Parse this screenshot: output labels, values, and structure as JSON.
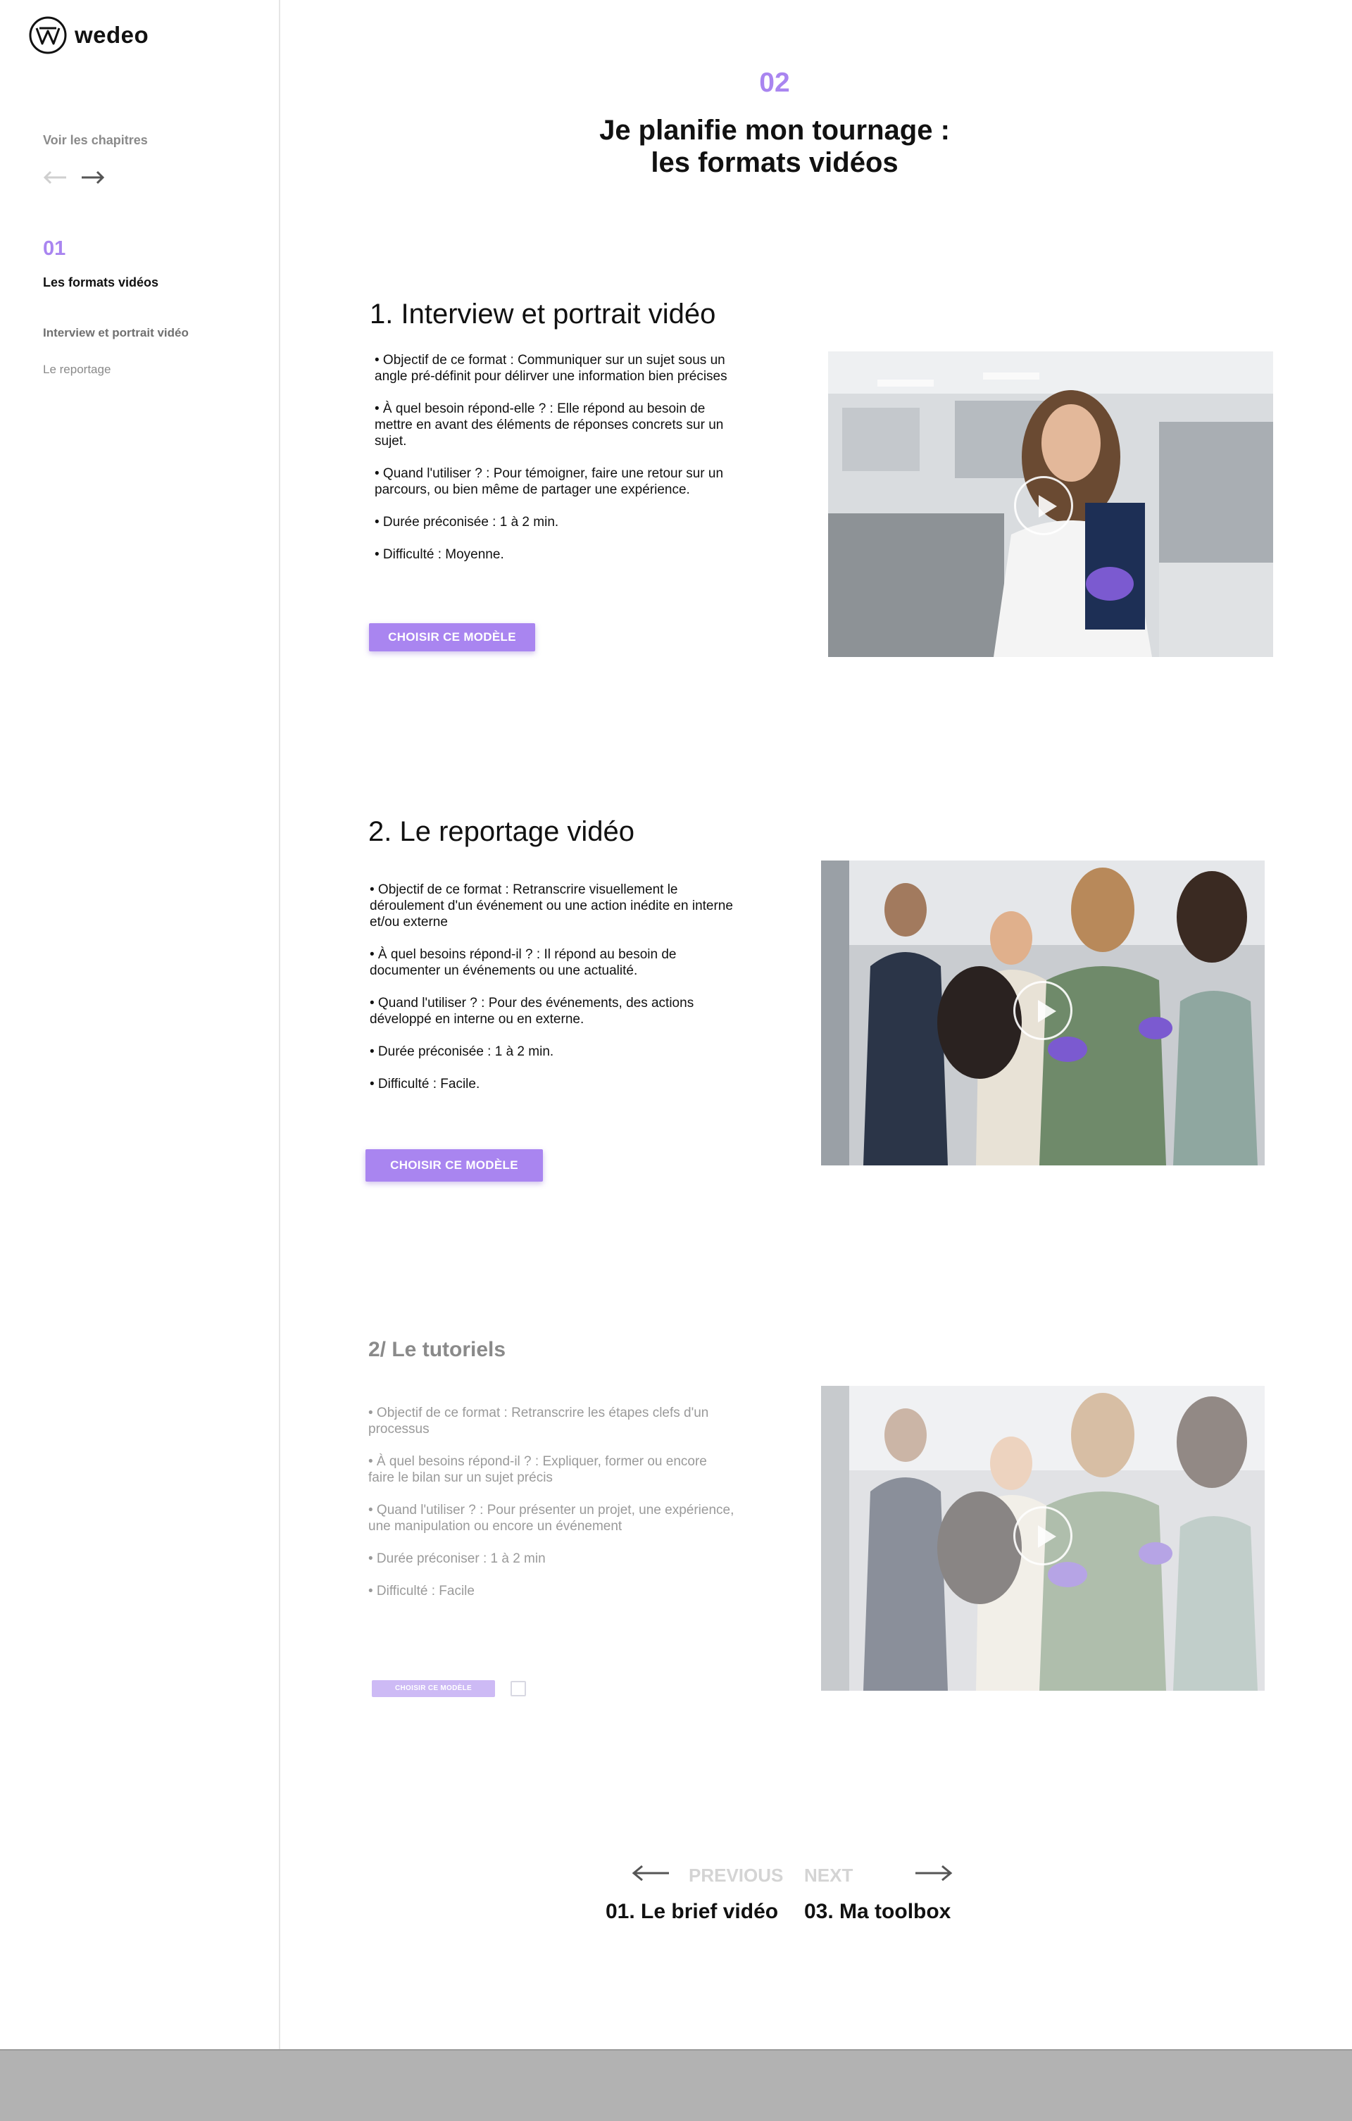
{
  "brand": {
    "name": "wedeo"
  },
  "sidebar": {
    "chapters_label": "Voir les chapitres",
    "current_number": "01",
    "current_title": "Les formats vidéos",
    "items": [
      {
        "label": "Interview et portrait vidéo"
      },
      {
        "label": "Le reportage"
      }
    ]
  },
  "header": {
    "chapter_number": "02",
    "title_line1": "Je planifie mon tournage :",
    "title_line2": "les formats vidéos"
  },
  "sections": [
    {
      "title": "1. Interview et portrait vidéo",
      "bullets": [
        "• Objectif de ce format : Communiquer sur un sujet sous un angle pré-définit pour délirver une information bien précises",
        "• À quel besoin répond-elle ? : Elle répond au besoin de mettre en avant des éléments de réponses concrets sur un sujet.",
        "• Quand l'utiliser ? : Pour témoigner, faire une retour sur un parcours, ou bien même de partager une expérience.",
        "• Durée préconisée : 1 à 2 min.",
        "• Difficulté : Moyenne."
      ],
      "cta": "CHOISIR CE MODÈLE"
    },
    {
      "title": "2. Le reportage vidéo",
      "bullets": [
        "• Objectif de ce format : Retranscrire visuellement le déroulement d'un événement ou une action inédite en interne et/ou externe",
        "• À quel besoins répond-il ? : Il répond au besoin de documenter un événements ou une actualité.",
        "• Quand l'utiliser ? : Pour des événements, des actions développé en interne ou en externe.",
        "• Durée préconisée : 1 à 2 min.",
        "• Difficulté : Facile."
      ],
      "cta": "CHOISIR CE MODÈLE"
    },
    {
      "title": "2/ Le tutoriels",
      "bullets": [
        "• Objectif de ce format : Retranscrire les étapes clefs d'un processus",
        "• À quel besoins répond-il ? : Expliquer, former ou encore faire le bilan sur un sujet précis",
        "• Quand l'utiliser ? : Pour présenter un projet, une expérience, une manipulation ou encore un événement",
        "• Durée préconiser : 1 à 2 min",
        "• Difficulté : Facile"
      ],
      "cta": "CHOISIR CE MODÈLE"
    }
  ],
  "pager": {
    "prev_label": "PREVIOUS",
    "next_label": "NEXT",
    "prev_title": "01. Le brief vidéo",
    "next_title": "03. Ma toolbox"
  },
  "colors": {
    "accent": "#a985f0",
    "accent_light": "#cdbaf5",
    "footer": "#b2b2b2"
  },
  "icons": [
    "wedeo-logo-icon",
    "arrow-left-icon",
    "arrow-right-icon",
    "play-icon"
  ]
}
